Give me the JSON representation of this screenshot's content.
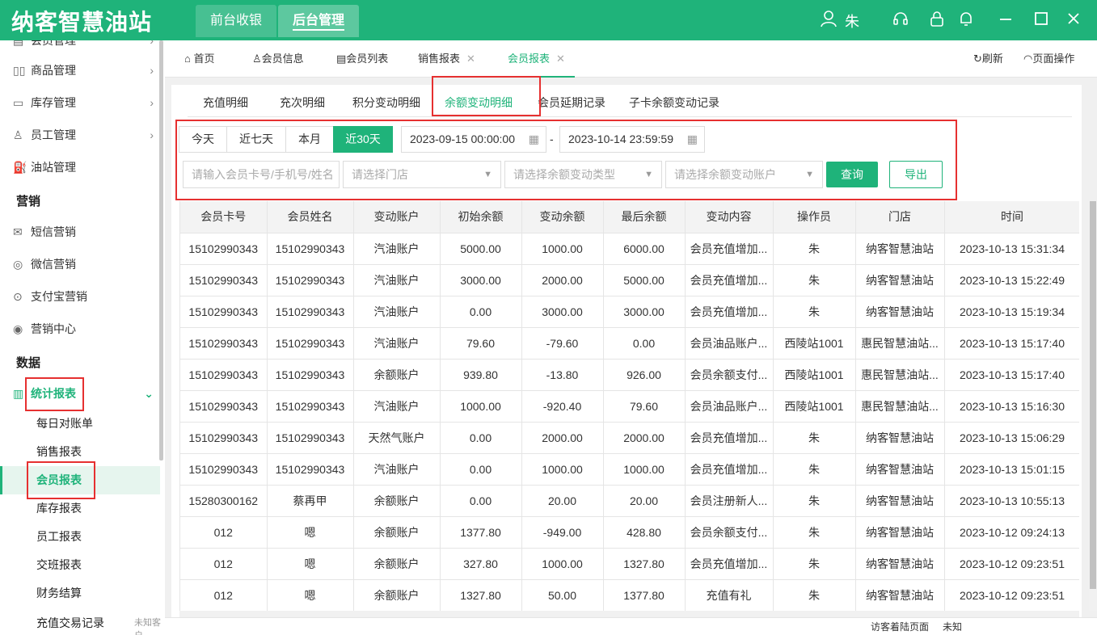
{
  "app": {
    "logo": "纳客智慧油站",
    "top_tabs": [
      "前台收银",
      "后台管理"
    ],
    "user": "朱"
  },
  "sidebar": {
    "items": [
      {
        "label": "会员管理"
      },
      {
        "label": "商品管理"
      },
      {
        "label": "库存管理"
      },
      {
        "label": "员工管理"
      },
      {
        "label": "油站管理"
      }
    ],
    "section_marketing": "营销",
    "marketing_items": [
      "短信营销",
      "微信营销",
      "支付宝营销",
      "营销中心"
    ],
    "section_data": "数据",
    "stats_label": "统计报表",
    "sub_items": [
      "每日对账单",
      "销售报表",
      "会员报表",
      "库存报表",
      "员工报表",
      "交班报表",
      "财务结算",
      "充值交易记录"
    ],
    "bottom_text": "未知客户"
  },
  "page_tabs": [
    {
      "label": "首页"
    },
    {
      "label": "会员信息"
    },
    {
      "label": "会员列表"
    },
    {
      "label": "销售报表"
    },
    {
      "label": "会员报表"
    }
  ],
  "page_actions": {
    "refresh": "刷新",
    "page_ops": "页面操作"
  },
  "sub_tabs": [
    "充值明细",
    "充次明细",
    "积分变动明细",
    "余额变动明细",
    "会员延期记录",
    "子卡余额变动记录"
  ],
  "filters": {
    "ranges": [
      "今天",
      "近七天",
      "本月",
      "近30天"
    ],
    "date_start": "2023-09-15 00:00:00",
    "date_sep": "-",
    "date_end": "2023-10-14 23:59:59",
    "member_placeholder": "请输入会员卡号/手机号/姓名",
    "store_placeholder": "请选择门店",
    "type_placeholder": "请选择余额变动类型",
    "account_placeholder": "请选择余额变动账户",
    "query": "查询",
    "export": "导出"
  },
  "table": {
    "columns": [
      "会员卡号",
      "会员姓名",
      "变动账户",
      "初始余额",
      "变动余额",
      "最后余额",
      "变动内容",
      "操作员",
      "门店",
      "时间"
    ],
    "rows": [
      [
        "15102990343",
        "15102990343",
        "汽油账户",
        "5000.00",
        "1000.00",
        "6000.00",
        "会员充值增加...",
        "朱",
        "纳客智慧油站",
        "2023-10-13 15:31:34"
      ],
      [
        "15102990343",
        "15102990343",
        "汽油账户",
        "3000.00",
        "2000.00",
        "5000.00",
        "会员充值增加...",
        "朱",
        "纳客智慧油站",
        "2023-10-13 15:22:49"
      ],
      [
        "15102990343",
        "15102990343",
        "汽油账户",
        "0.00",
        "3000.00",
        "3000.00",
        "会员充值增加...",
        "朱",
        "纳客智慧油站",
        "2023-10-13 15:19:34"
      ],
      [
        "15102990343",
        "15102990343",
        "汽油账户",
        "79.60",
        "-79.60",
        "0.00",
        "会员油品账户...",
        "西陵站1001",
        "惠民智慧油站...",
        "2023-10-13 15:17:40"
      ],
      [
        "15102990343",
        "15102990343",
        "余额账户",
        "939.80",
        "-13.80",
        "926.00",
        "会员余额支付...",
        "西陵站1001",
        "惠民智慧油站...",
        "2023-10-13 15:17:40"
      ],
      [
        "15102990343",
        "15102990343",
        "汽油账户",
        "1000.00",
        "-920.40",
        "79.60",
        "会员油品账户...",
        "西陵站1001",
        "惠民智慧油站...",
        "2023-10-13 15:16:30"
      ],
      [
        "15102990343",
        "15102990343",
        "天然气账户",
        "0.00",
        "2000.00",
        "2000.00",
        "会员充值增加...",
        "朱",
        "纳客智慧油站",
        "2023-10-13 15:06:29"
      ],
      [
        "15102990343",
        "15102990343",
        "汽油账户",
        "0.00",
        "1000.00",
        "1000.00",
        "会员充值增加...",
        "朱",
        "纳客智慧油站",
        "2023-10-13 15:01:15"
      ],
      [
        "15280300162",
        "蔡再甲",
        "余额账户",
        "0.00",
        "20.00",
        "20.00",
        "会员注册新人...",
        "朱",
        "纳客智慧油站",
        "2023-10-13 10:55:13"
      ],
      [
        "012",
        "嗯",
        "余额账户",
        "1377.80",
        "-949.00",
        "428.80",
        "会员余额支付...",
        "朱",
        "纳客智慧油站",
        "2023-10-12 09:24:13"
      ],
      [
        "012",
        "嗯",
        "余额账户",
        "327.80",
        "1000.00",
        "1327.80",
        "会员充值增加...",
        "朱",
        "纳客智慧油站",
        "2023-10-12 09:23:51"
      ],
      [
        "012",
        "嗯",
        "余额账户",
        "1327.80",
        "50.00",
        "1377.80",
        "充值有礼",
        "朱",
        "纳客智慧油站",
        "2023-10-12 09:23:51"
      ]
    ]
  },
  "footer": {
    "label": "访客着陆页面",
    "value": "未知"
  }
}
